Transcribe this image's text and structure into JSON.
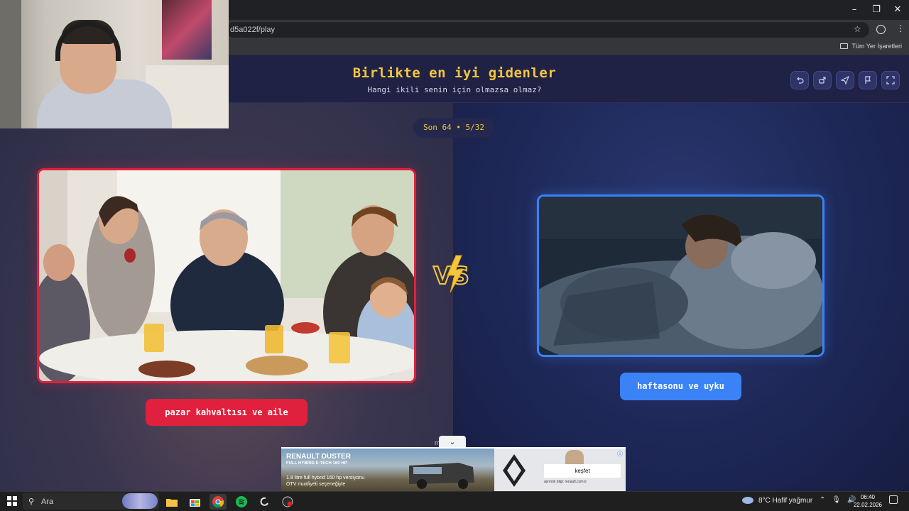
{
  "browser": {
    "url_fragment": "d5a022f/play",
    "bookmarks_label": "Tüm Yer İşaretleri",
    "window_controls": {
      "minimize": "–",
      "restore": "❐",
      "close": "✕"
    }
  },
  "game": {
    "title": "Birlikte en iyi gidenler",
    "subtitle": "Hangi ikili senin için olmazsa olmaz?",
    "round": "Son 64 • 5/32",
    "vs": "VS",
    "header_buttons": [
      "undo-icon",
      "share-icon",
      "send-icon",
      "flag-icon",
      "fullscreen-icon"
    ],
    "left_option": {
      "label": "pazar kahvaltısı ve aile",
      "color": "#e0203c"
    },
    "right_option": {
      "label": "haftasonu ve uyku",
      "color": "#3b82f6"
    },
    "accent_color": "#f3c63f",
    "below_peek": "m          h"
  },
  "ad": {
    "brand": "RENAULT DUSTER",
    "tagline": "FULL HYBRID E-TECH 160 HP",
    "line1": "1.8 litre full hybrid 160 hp versiyonu",
    "line2": "ÖTV muafiyeti seçeneğiyle",
    "cta": "keşfet",
    "info": "ayrıntılı bilgi: renault.com.tr"
  },
  "taskbar": {
    "search_placeholder": "Ara",
    "apps": [
      "file-explorer-icon",
      "store-icon",
      "chrome-icon",
      "spotify-icon",
      "logitech-icon",
      "recorder-icon"
    ],
    "weather": "8°C  Hafif yağmur",
    "time": "06:40",
    "date": "22.02.2026"
  }
}
